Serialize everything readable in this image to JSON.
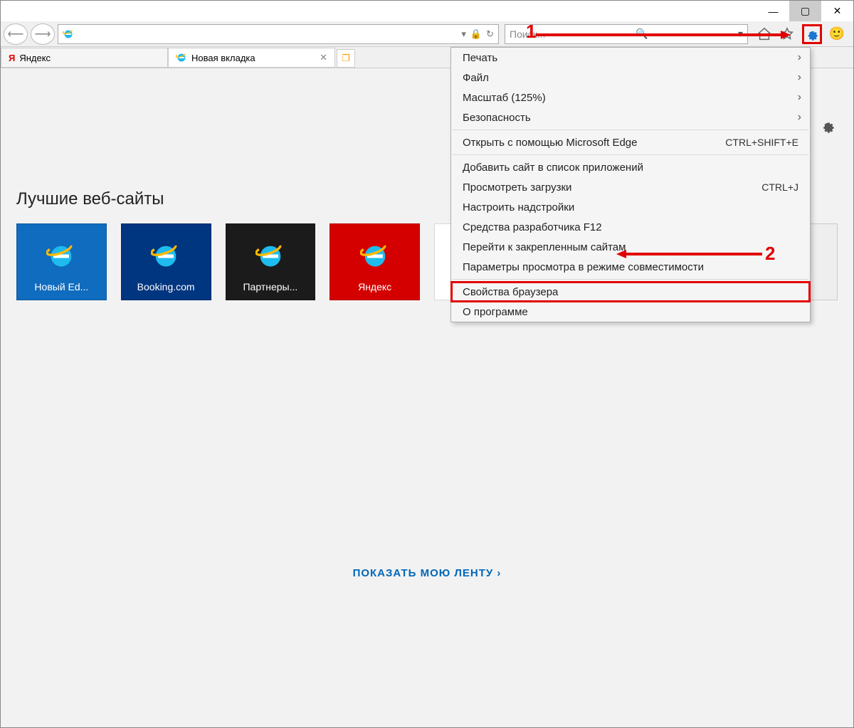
{
  "window": {
    "minimize": "—",
    "maximize": "▢",
    "close": "✕"
  },
  "toolbar": {
    "back": "⟵",
    "forward": "⟶",
    "search_placeholder": "Поиск...",
    "lock": "🔒",
    "refresh": "↻",
    "dropdown": "▾"
  },
  "tabs": [
    {
      "label": "Яндекс",
      "icon": "Я"
    },
    {
      "label": "Новая вкладка",
      "icon": "ie"
    }
  ],
  "page": {
    "heading": "Лучшие веб-сайты",
    "feed_link": "ПОКАЗАТЬ МОЮ ЛЕНТУ ›"
  },
  "tiles": [
    {
      "label": "Новый  Ed...",
      "class": "edge"
    },
    {
      "label": "Booking.com",
      "class": "booking"
    },
    {
      "label": "Партнеры...",
      "class": "part"
    },
    {
      "label": "Яндекс",
      "class": "yandex"
    },
    {
      "label": "",
      "class": "blank"
    },
    {
      "label": "",
      "class": "fb"
    },
    {
      "label": "",
      "class": "orange"
    },
    {
      "label": "",
      "class": "grey"
    }
  ],
  "menu": {
    "items": [
      {
        "label": "Печать",
        "sub": true
      },
      {
        "label": "Файл",
        "sub": true
      },
      {
        "label": "Масштаб (125%)",
        "sub": true
      },
      {
        "label": "Безопасность",
        "sub": true
      }
    ],
    "items2": [
      {
        "label": "Открыть с помощью Microsoft Edge",
        "shortcut": "CTRL+SHIFT+E"
      }
    ],
    "items3": [
      {
        "label": "Добавить сайт в список приложений"
      },
      {
        "label": "Просмотреть загрузки",
        "shortcut": "CTRL+J"
      },
      {
        "label": "Настроить надстройки"
      },
      {
        "label": "Средства разработчика F12"
      },
      {
        "label": "Перейти к закрепленным сайтам"
      },
      {
        "label": "Параметры просмотра в режиме совместимости"
      }
    ],
    "items4": [
      {
        "label": "Свойства браузера",
        "framed": true
      },
      {
        "label": "О программе"
      }
    ]
  },
  "annotations": {
    "one": "1",
    "two": "2"
  }
}
